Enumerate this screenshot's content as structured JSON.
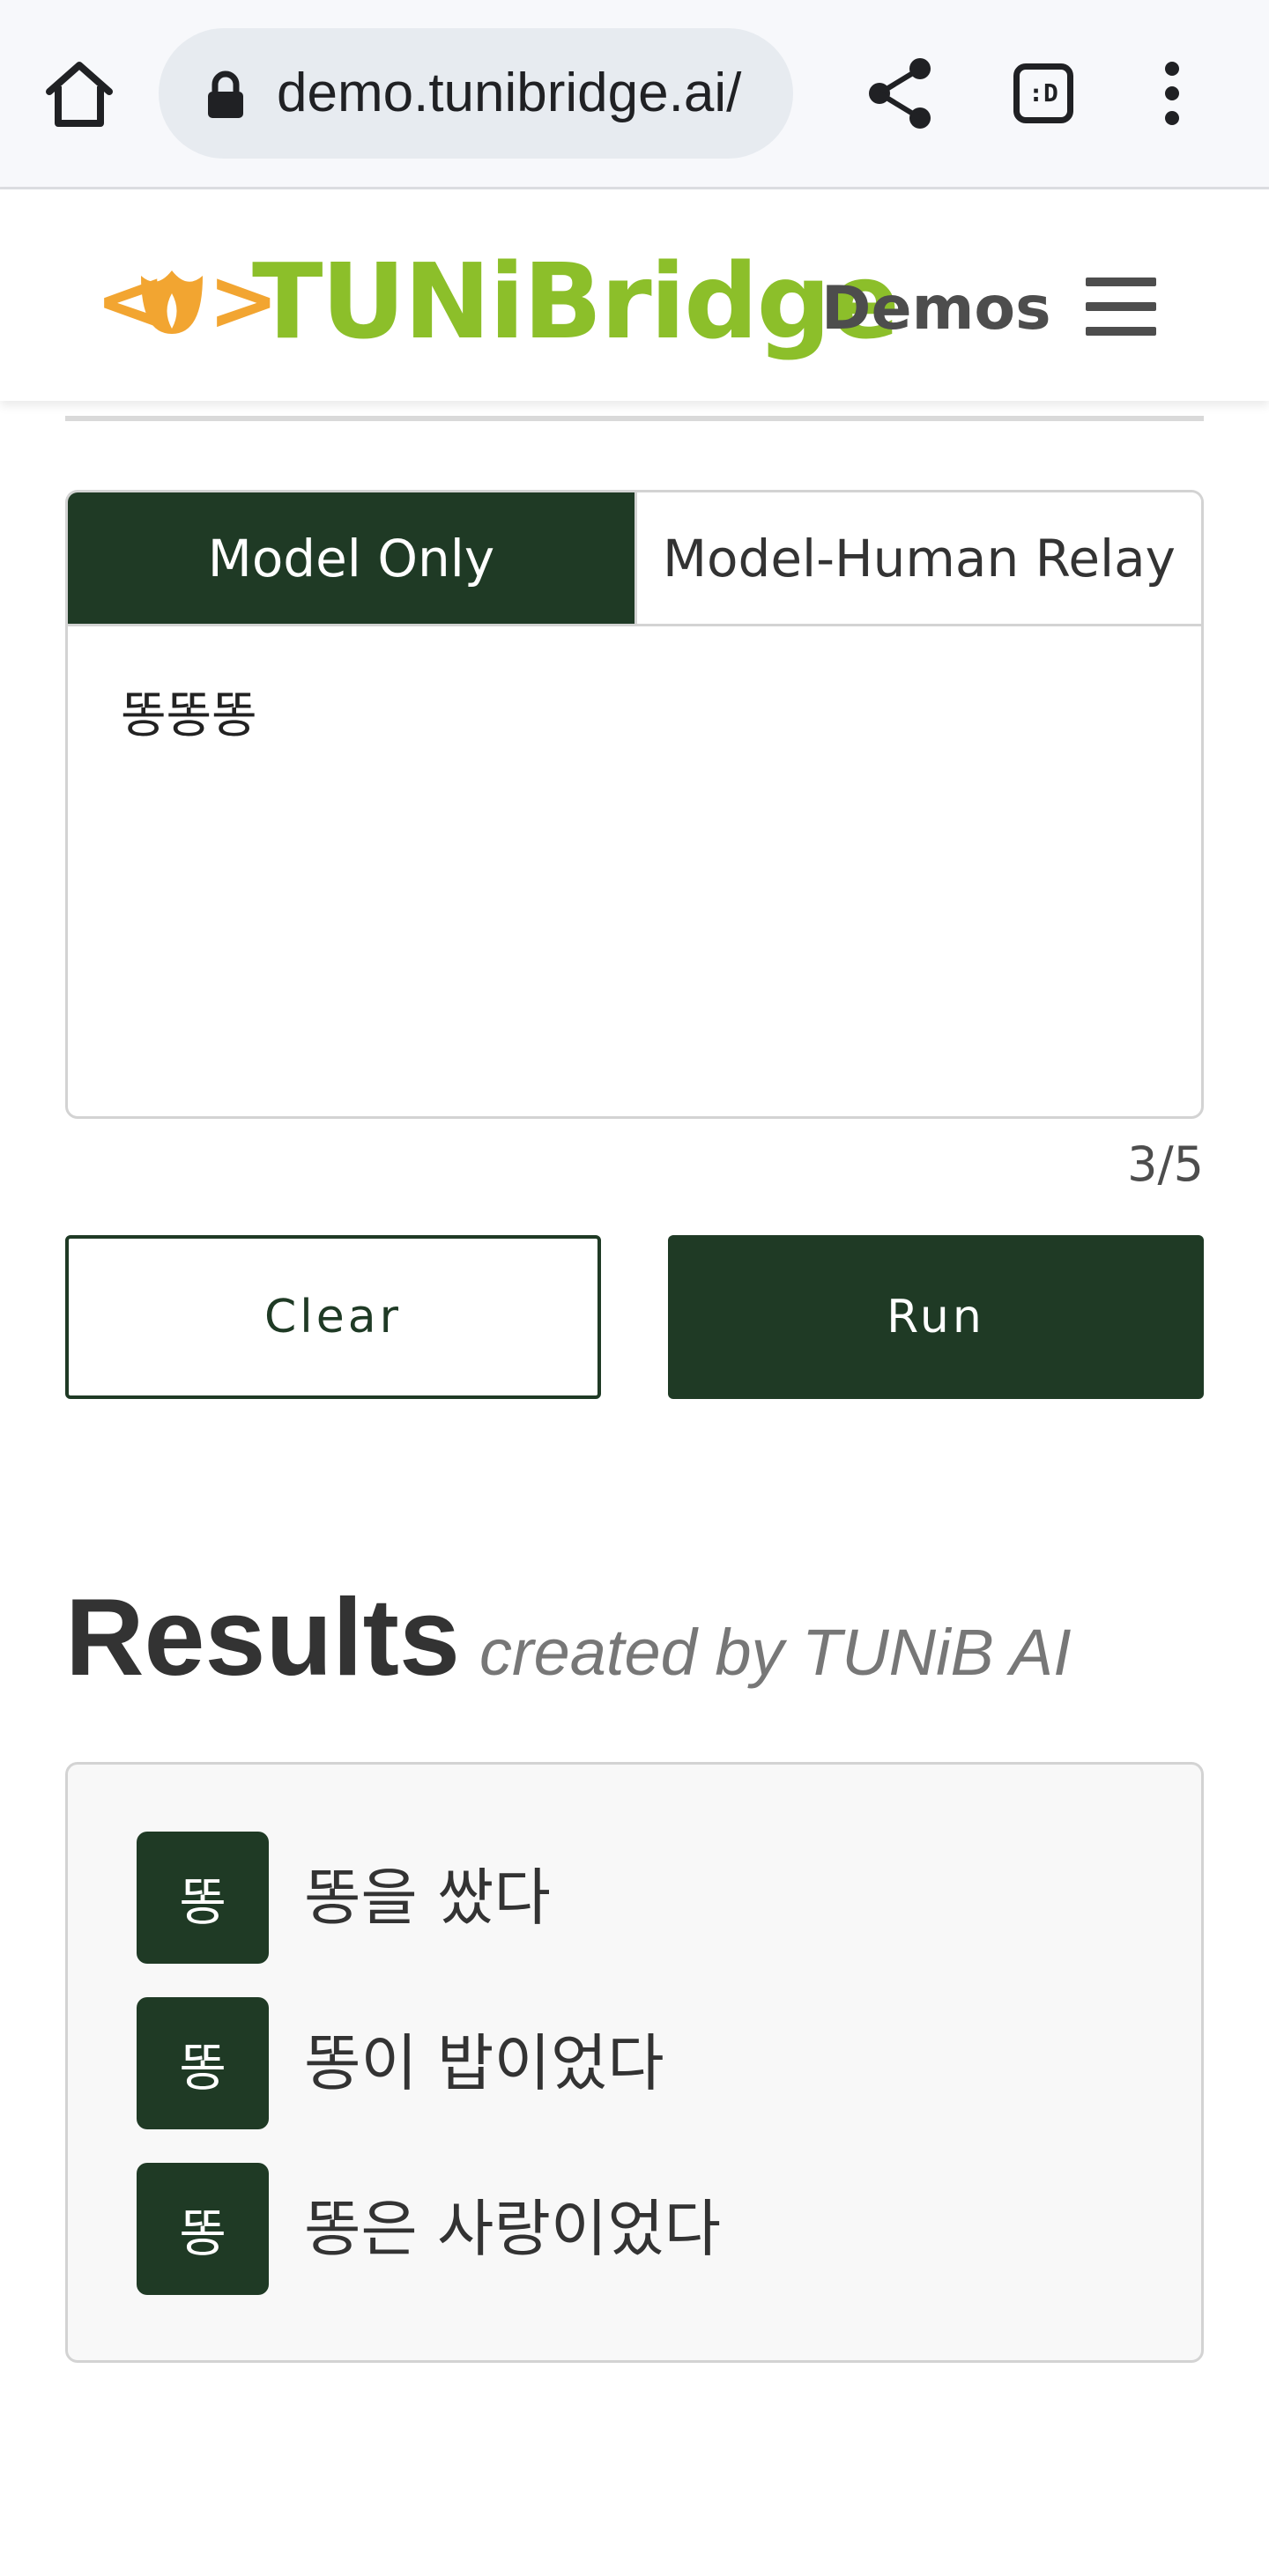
{
  "browser": {
    "url": "demo.tunibridge.ai/",
    "tabs_label": ":D"
  },
  "header": {
    "logo_text": "TUNiBridge",
    "nav_label": "Demos"
  },
  "mode_tabs": [
    {
      "label": "Model Only",
      "active": true
    },
    {
      "label": "Model-Human Relay",
      "active": false
    }
  ],
  "input": {
    "value": "똥똥똥",
    "char_count": "3/5"
  },
  "buttons": {
    "clear_label": "Clear",
    "run_label": "Run"
  },
  "results": {
    "title": "Results",
    "subtitle": "created by TUNiB AI",
    "items": [
      {
        "badge": "똥",
        "text": "똥을 쌌다"
      },
      {
        "badge": "똥",
        "text": "똥이 밥이었다"
      },
      {
        "badge": "똥",
        "text": "똥은 사랑이었다"
      }
    ]
  },
  "colors": {
    "primary": "#1f3a25",
    "logo_green": "#8cbf2a",
    "logo_orange": "#f2a531"
  },
  "icons": [
    "home-icon",
    "lock-icon",
    "share-icon",
    "tab-switcher-icon",
    "overflow-menu-icon",
    "hamburger-menu-icon"
  ]
}
